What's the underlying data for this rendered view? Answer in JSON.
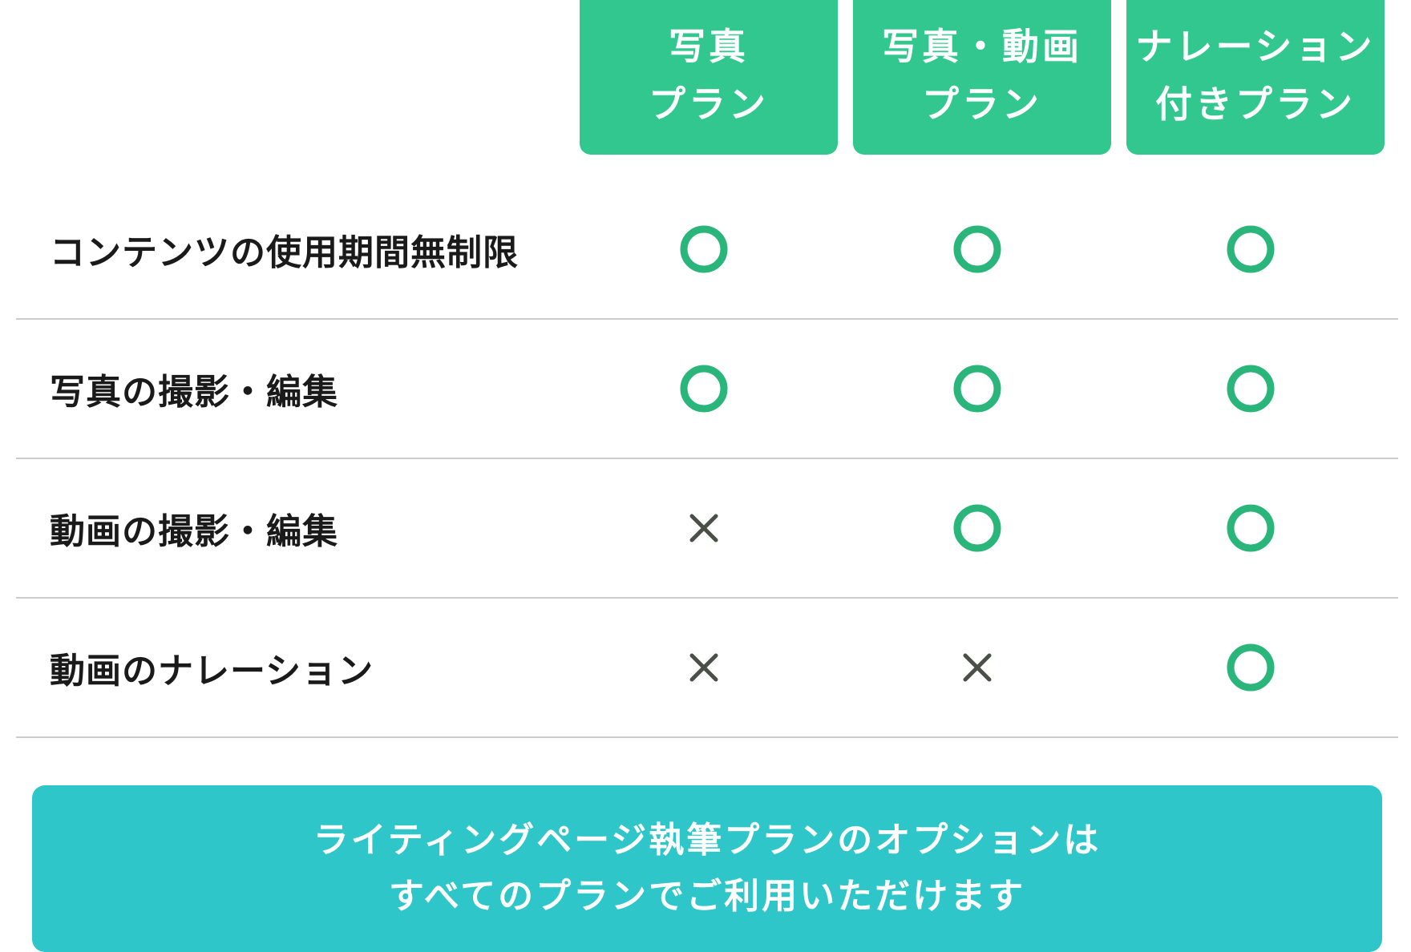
{
  "colors": {
    "header_bg": "#32c78e",
    "check_green": "#2ab57b",
    "cross_gray": "#4a5048",
    "divider": "#cccccc",
    "notice_bg": "#2ec6c8"
  },
  "plans": [
    {
      "line1": "写真",
      "line2": "プラン"
    },
    {
      "line1": "写真・動画",
      "line2": "プラン"
    },
    {
      "line1": "ナレーション",
      "line2": "付きプラン"
    }
  ],
  "features": [
    {
      "label": "コンテンツの使用期間無制限",
      "availability": [
        "circle-icon",
        "circle-icon",
        "circle-icon"
      ]
    },
    {
      "label": "写真の撮影・編集",
      "availability": [
        "circle-icon",
        "circle-icon",
        "circle-icon"
      ]
    },
    {
      "label": "動画の撮影・編集",
      "availability": [
        "cross-icon",
        "circle-icon",
        "circle-icon"
      ]
    },
    {
      "label": "動画のナレーション",
      "availability": [
        "cross-icon",
        "cross-icon",
        "circle-icon"
      ]
    }
  ],
  "notice": {
    "line1": "ライティングページ執筆プランのオプションは",
    "line2": "すべてのプランでご利用いただけます"
  }
}
